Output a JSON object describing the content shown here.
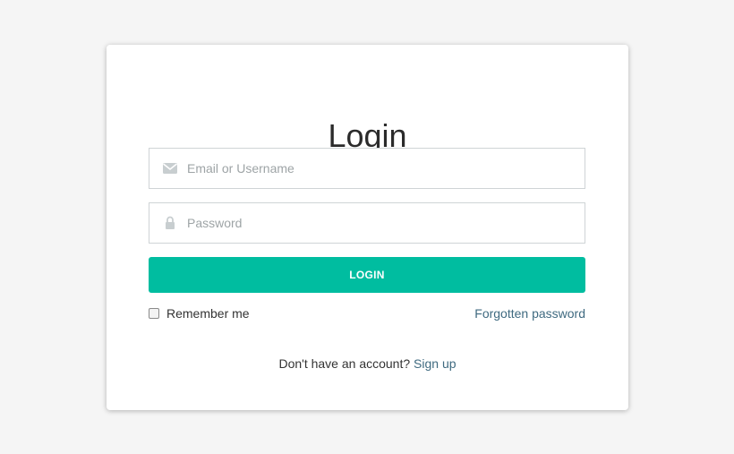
{
  "login": {
    "title": "Login",
    "email_placeholder": "Email or Username",
    "password_placeholder": "Password",
    "login_button_label": "LOGIN",
    "remember_label": "Remember me",
    "forgot_label": "Forgotten password",
    "no_account_text": "Don't have an account?",
    "signup_label": "Sign up"
  },
  "icons": {
    "email": "envelope-icon",
    "password": "lock-icon"
  },
  "colors": {
    "accent": "#00bda0",
    "link": "#3f6a80",
    "icon": "#c8ced0"
  }
}
